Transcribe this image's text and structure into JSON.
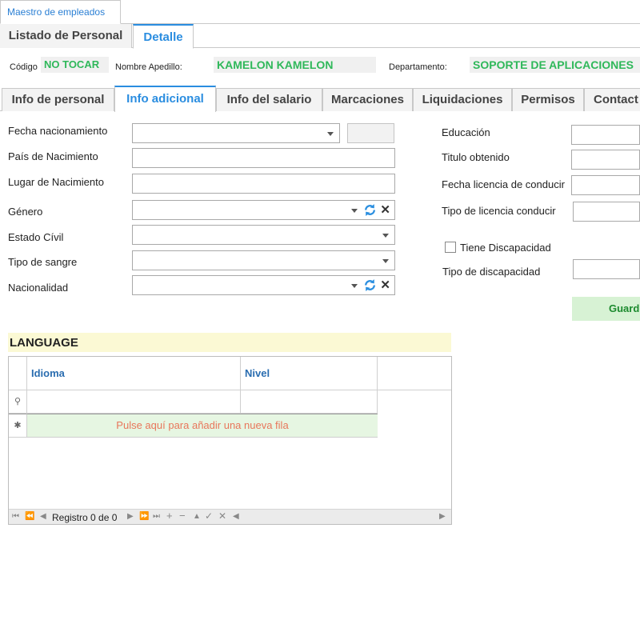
{
  "doc_tab": "Maestro de empleados",
  "main_tabs": [
    "Listado de Personal",
    "Detalle"
  ],
  "header": {
    "code_label": "Código",
    "code_value": "NO TOCAR",
    "name_label": "Nombre Apedillo:",
    "name_value": "KAMELON KAMELON",
    "dept_label": "Departamento:",
    "dept_value": "SOPORTE DE APLICACIONES"
  },
  "sub_tabs": [
    "Info de personal",
    "Info adicional",
    "Info del salario",
    "Marcaciones",
    "Liquidaciones",
    "Permisos",
    "Contact"
  ],
  "form_left": {
    "birth_date": "Fecha nacionamiento",
    "birth_country": "País de Nacimiento",
    "birth_place": "Lugar de Nacimiento",
    "gender": "Género",
    "civil_status": "Estado Cívil",
    "blood_type": "Tipo de sangre",
    "nationality": "Nacionalidad"
  },
  "form_right": {
    "education": "Educación",
    "title": "Titulo obtenido",
    "license_date": "Fecha licencia de conducir",
    "license_type": "Tipo de licencia conducir",
    "disability_check": "Tiene Discapacidad",
    "disability_type": "Tipo de discapacidad",
    "save": "Guard"
  },
  "language": {
    "title": "LANGUAGE",
    "columns": [
      "Idioma",
      "Nivel"
    ],
    "new_row": "Pulse aquí para añadir una nueva fila",
    "record": "Registro 0 de 0"
  },
  "colors": {
    "accent": "#2a8de0",
    "value_green": "#2fb85a",
    "new_row_text": "#e8765b"
  }
}
